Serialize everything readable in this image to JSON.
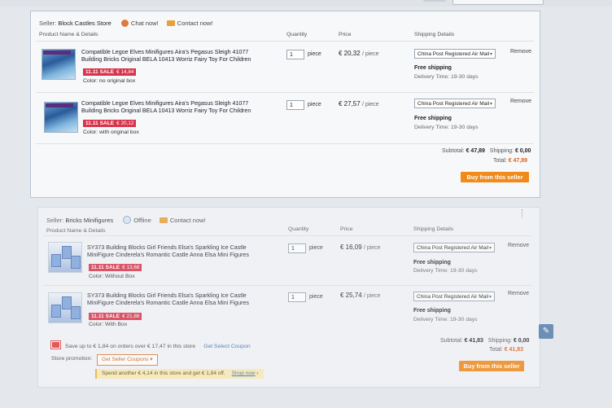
{
  "store1": {
    "seller_label": "Seller:",
    "seller_name": "Block Castles Store",
    "chat": "Chat now!",
    "contact": "Contact now!",
    "columns": {
      "product": "Product Name & Details",
      "quantity": "Quantity",
      "price": "Price",
      "shipping": "Shipping Details"
    },
    "items": [
      {
        "thumb_icon": "lego-sleigh-product-image",
        "title": "Compatible Legoe Elves Minifigures Aira's Pegasus Sleigh 41077 Building Bricks Original BELA 10413 Worriz Fairy Toy For Children",
        "sale_tag": "11.11 SALE",
        "sale_price": "€ 14,84",
        "color": "Color: no original box",
        "qty": "1",
        "unit": "piece",
        "price": "€ 20,32",
        "per": "/ piece",
        "shipping_method": "China Post Registered Air Mail",
        "free_shipping": "Free shipping",
        "delivery": "Delivery Time: 19-30 days",
        "remove": "Remove"
      },
      {
        "thumb_icon": "lego-sleigh-product-image",
        "title": "Compatible Legoe Elves Minifigures Aira's Pegasus Sleigh 41077 Building Bricks Original BELA 10413 Worriz Fairy Toy For Children",
        "sale_tag": "11.11 SALE",
        "sale_price": "€ 20,12",
        "color": "Color: with original box",
        "qty": "1",
        "unit": "piece",
        "price": "€ 27,57",
        "per": "/ piece",
        "shipping_method": "China Post Registered Air Mail",
        "free_shipping": "Free shipping",
        "delivery": "Delivery Time: 19-30 days",
        "remove": "Remove"
      }
    ],
    "subtotal_label": "Subtotal:",
    "subtotal": "€ 47,89",
    "shipping_label": "Shipping:",
    "shipping": "€ 0,00",
    "total_label": "Total:",
    "total": "€ 47,89",
    "buy": "Buy from this seller"
  },
  "store2": {
    "seller_label": "Seller:",
    "seller_name": "Bricks Minifigures",
    "offline": "Offline",
    "contact": "Contact now!",
    "columns": {
      "product": "Product Name & Details",
      "quantity": "Quantity",
      "price": "Price",
      "shipping": "Shipping Details"
    },
    "items": [
      {
        "thumb_icon": "ice-castle-product-image",
        "title": "SY373 Building Blocks Girl Friends Elsa's Sparkling Ice Castle MiniFigure Cinderela's Romantic Castle Anna Elsa Mini Figures",
        "sale_tag": "11.11 SALE",
        "sale_price": "€ 13,68",
        "color": "Color: Without Box",
        "qty": "1",
        "unit": "piece",
        "price": "€ 16,09",
        "per": "/ piece",
        "shipping_method": "China Post Registered Air Mail",
        "free_shipping": "Free shipping",
        "delivery": "Delivery Time: 19-30 days",
        "remove": "Remove"
      },
      {
        "thumb_icon": "ice-castle-product-image",
        "title": "SY373 Building Blocks Girl Friends Elsa's Sparkling Ice Castle MiniFigure Cinderela's Romantic Castle Anna Elsa Mini Figures",
        "sale_tag": "11.11 SALE",
        "sale_price": "€ 21,88",
        "color": "Color: With Box",
        "qty": "1",
        "unit": "piece",
        "price": "€ 25,74",
        "per": "/ piece",
        "shipping_method": "China Post Registered Air Mail",
        "free_shipping": "Free shipping",
        "delivery": "Delivery Time: 19-30 days",
        "remove": "Remove"
      }
    ],
    "save_text": "Save up to € 1,84 on orders over € 17,47 in this store",
    "coupon_link": "Get Select Coupon",
    "promo_label": "Store promotion:",
    "coupon_button": "Get Seller Coupons",
    "spend_text": "Spend another € 4,14 in this store and get € 1,84 off.",
    "shop_now": "Shop now",
    "subtotal_label": "Subtotal:",
    "subtotal": "€ 41,83",
    "shipping_label": "Shipping:",
    "shipping": "€ 0,00",
    "total_label": "Total:",
    "total": "€ 41,83",
    "buy": "Buy from this seller"
  },
  "colors": {
    "accent": "#f08a1a",
    "sale": "#d8334b",
    "total": "#e05f1a",
    "link": "#3a6fb0"
  }
}
